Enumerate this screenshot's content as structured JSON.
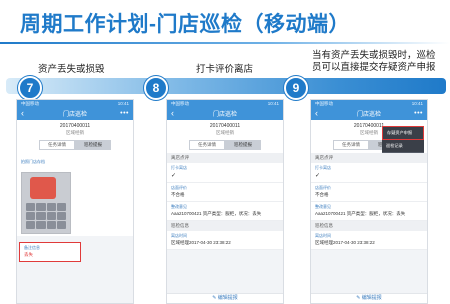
{
  "title": "周期工作计划-门店巡检（移动端）",
  "steps": [
    {
      "num": "7",
      "caption": "资产丢失或损毁"
    },
    {
      "num": "8",
      "caption": "打卡评价离店"
    },
    {
      "num": "9",
      "caption_line1": "当有资产丢失或损毁时，巡检",
      "caption_line2": "员可以直接提交存疑资产申报"
    }
  ],
  "phone": {
    "status_left": "中国移动",
    "status_right": "10:41",
    "nav_title": "门店巡检",
    "store_code": "20170400011",
    "store_name": "区域经销",
    "tab1": "任务详情",
    "tab2": "巡检提报"
  },
  "phone7": {
    "link": "拍照门店存档",
    "field_label": "备注信息",
    "field_value": "丢失"
  },
  "phone8": {
    "sec1": "离店点评",
    "f1_label": "打卡离店",
    "f1_value": "✓",
    "f2_label": "店面评价",
    "f2_value": "不合格",
    "f3_label": "整改意见",
    "f3_value": "Aaa210700421 资产类型：服柜，状况：丢失",
    "sec2": "巡检信息",
    "f4_label": "离店时间",
    "f4_value": "区域经理2017-04-30 23:38:22",
    "footer": "编辑提报"
  },
  "phone9": {
    "dropdown_item1": "存疑资产申报",
    "dropdown_item2": "巡检记录",
    "sec1": "离店点评",
    "f1_label": "打卡离店",
    "f1_value": "✓",
    "f2_label": "店面评价",
    "f2_value": "不合格",
    "f3_label": "整改意见",
    "f3_value": "Aaa210700421 资产类型：服柜，状况：丢失",
    "sec2": "巡检信息",
    "f4_label": "离店时间",
    "f4_value": "区域经理2017-04-30 23:38:22",
    "footer": "编辑提报"
  },
  "colors": {
    "accent": "#1f7ac9",
    "nav": "#3f93d9",
    "highlight": "#e03a3a"
  }
}
